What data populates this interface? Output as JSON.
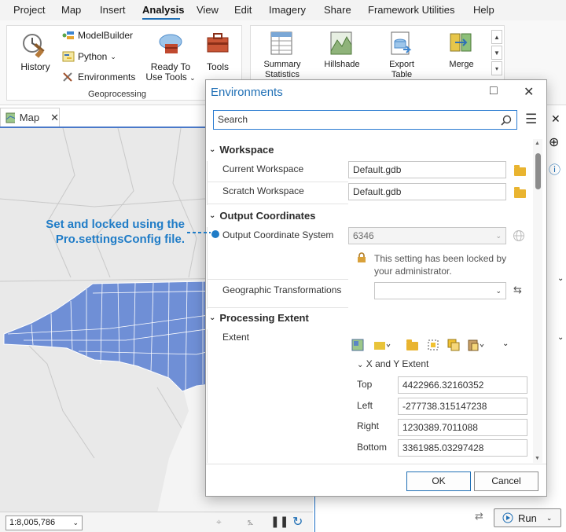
{
  "menu": [
    "Project",
    "Map",
    "Insert",
    "Analysis",
    "View",
    "Edit",
    "Imagery",
    "Share",
    "Framework Utilities",
    "Help"
  ],
  "menu_active": "Analysis",
  "ribbon": {
    "history": "History",
    "modelbuilder": "ModelBuilder",
    "python": "Python",
    "environments": "Environments",
    "ready_to_use_1": "Ready To",
    "ready_to_use_2": "Use Tools",
    "tools": "Tools",
    "group_label": "Geoprocessing",
    "gallery": [
      {
        "l1": "Summary",
        "l2": "Statistics"
      },
      {
        "l1": "Hillshade",
        "l2": ""
      },
      {
        "l1": "Export",
        "l2": "Table"
      },
      {
        "l1": "Merge",
        "l2": ""
      }
    ]
  },
  "map": {
    "tab_label": "Map",
    "scale": "1:8,005,786"
  },
  "annotation": {
    "line1": "Set and locked using the",
    "line2": "Pro.settingsConfig file."
  },
  "dialog": {
    "title": "Environments",
    "search_placeholder": "Search",
    "sections": {
      "workspace": "Workspace",
      "output_coordinates": "Output Coordinates",
      "processing_extent": "Processing Extent"
    },
    "current_workspace": {
      "label": "Current Workspace",
      "value": "Default.gdb"
    },
    "scratch_workspace": {
      "label": "Scratch Workspace",
      "value": "Default.gdb"
    },
    "output_coordinate_system": {
      "label": "Output Coordinate System",
      "value": "6346"
    },
    "lock_message_1": "This setting has been locked by",
    "lock_message_2": "your administrator.",
    "geographic_transformations": {
      "label": "Geographic Transformations",
      "value": ""
    },
    "extent": {
      "label": "Extent",
      "xy_header": "X and Y Extent",
      "top": {
        "label": "Top",
        "value": "4422966.32160352"
      },
      "left": {
        "label": "Left",
        "value": "-277738.315147238"
      },
      "right": {
        "label": "Right",
        "value": "1230389.7011088"
      },
      "bottom": {
        "label": "Bottom",
        "value": "3361985.03297428"
      }
    },
    "ok": "OK",
    "cancel": "Cancel"
  },
  "geoprocessing_pane": {
    "run": "Run"
  },
  "colors": {
    "accent": "#1f6fb5",
    "annotation": "#1f7cc7",
    "county_fill": "#6f8fd6",
    "folder": "#e9b430"
  }
}
